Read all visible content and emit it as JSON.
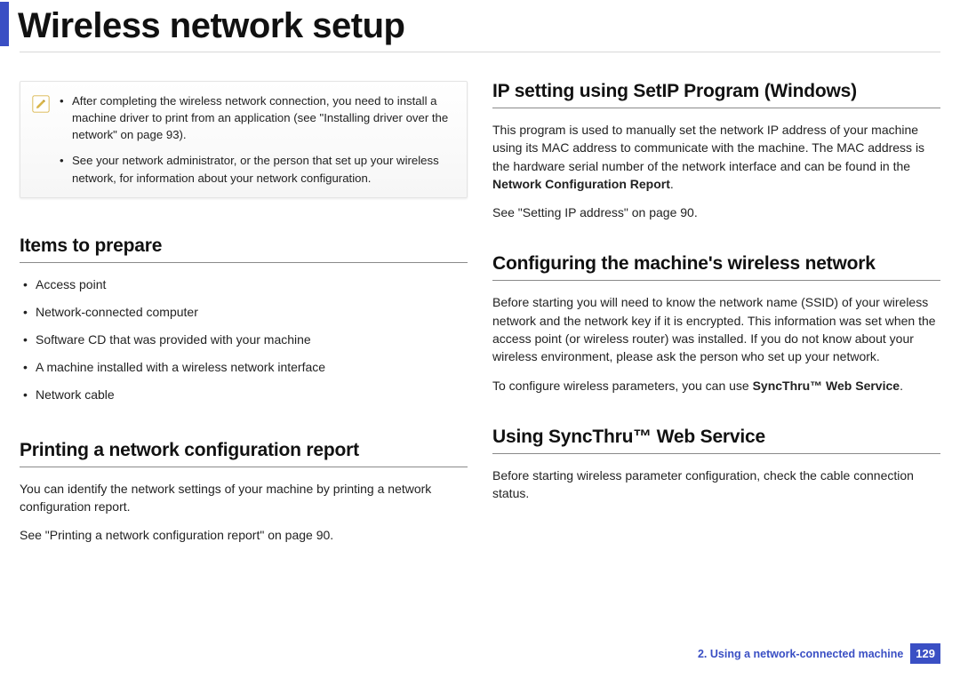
{
  "pageTitle": "Wireless network setup",
  "noteBox": {
    "items": [
      "After completing the wireless network connection, you need to install a machine driver to print from an application (see \"Installing driver over the network\" on page 93).",
      "See your network administrator, or the person that set up your wireless network, for information about your network configuration."
    ]
  },
  "left": {
    "itemsHeading": "Items to prepare",
    "itemsList": [
      "Access point",
      "Network-connected computer",
      "Software CD that was provided with your machine",
      "A machine installed with a wireless network interface",
      "Network cable"
    ],
    "printHeading": "Printing a network configuration report",
    "printBody1": "You can identify the network settings of your machine by printing a network configuration report.",
    "printBody2": "See \"Printing a network configuration report\" on page 90."
  },
  "right": {
    "ipHeading": "IP setting using SetIP Program (Windows)",
    "ipBody1a": "This program is used to manually set the network IP address of your machine using its MAC address to communicate with the machine. The MAC address is the hardware serial number of the network interface and can be found in the ",
    "ipBody1b": "Network Configuration Report",
    "ipBody1c": ".",
    "ipBody2": "See \"Setting IP address\" on page 90.",
    "configHeading": "Configuring the machine's wireless network",
    "configBody1": "Before starting you will need to know the network name (SSID) of your wireless network and the network key if it is encrypted. This information was set when the access point (or wireless router) was installed. If you do not know about your wireless environment, please ask the person who set up your network.",
    "configBody2a": "To configure wireless parameters, you can use ",
    "configBody2b": "SyncThru™ Web Service",
    "configBody2c": ".",
    "syncHeading": "Using SyncThru™ Web Service",
    "syncBody1": "Before starting wireless parameter configuration, check the cable connection status."
  },
  "footer": {
    "chapter": "2.  Using a network-connected machine",
    "page": "129"
  }
}
